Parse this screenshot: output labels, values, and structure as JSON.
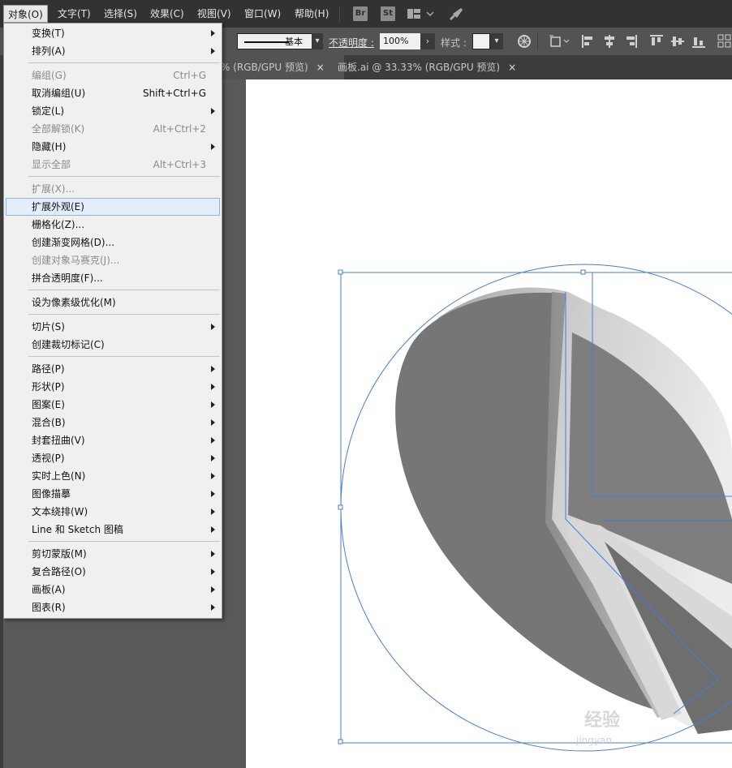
{
  "menubar": {
    "items": [
      {
        "label": "对象(O)"
      },
      {
        "label": "文字(T)"
      },
      {
        "label": "选择(S)"
      },
      {
        "label": "效果(C)"
      },
      {
        "label": "视图(V)"
      },
      {
        "label": "窗口(W)"
      },
      {
        "label": "帮助(H)"
      }
    ],
    "bridge_badge": "Br",
    "stock_badge": "St"
  },
  "control_bar": {
    "stroke_style": "基本",
    "opacity_label": "不透明度 :",
    "opacity_value": "100%",
    "style_label": "样式 :"
  },
  "tabs": [
    {
      "label": "% (RGB/GPU 预览)",
      "close": "×"
    },
    {
      "label": "画板.ai @ 33.33% (RGB/GPU 预览)",
      "close": "×"
    }
  ],
  "object_menu": {
    "items": [
      {
        "label": "变换(T)",
        "submenu": true
      },
      {
        "label": "排列(A)",
        "submenu": true
      },
      {
        "label": "编组(G)",
        "shortcut": "Ctrl+G",
        "disabled": true
      },
      {
        "label": "取消编组(U)",
        "shortcut": "Shift+Ctrl+G"
      },
      {
        "label": "锁定(L)",
        "submenu": true
      },
      {
        "label": "全部解锁(K)",
        "shortcut": "Alt+Ctrl+2",
        "disabled": true
      },
      {
        "label": "隐藏(H)",
        "submenu": true
      },
      {
        "label": "显示全部",
        "shortcut": "Alt+Ctrl+3",
        "disabled": true
      },
      {
        "label": "扩展(X)...",
        "disabled": true
      },
      {
        "label": "扩展外观(E)",
        "highlighted": true
      },
      {
        "label": "栅格化(Z)..."
      },
      {
        "label": "创建渐变网格(D)..."
      },
      {
        "label": "创建对象马赛克(J)...",
        "disabled": true
      },
      {
        "label": "拼合透明度(F)..."
      },
      {
        "label": "设为像素级优化(M)"
      },
      {
        "label": "切片(S)",
        "submenu": true
      },
      {
        "label": "创建裁切标记(C)"
      },
      {
        "label": "路径(P)",
        "submenu": true
      },
      {
        "label": "形状(P)",
        "submenu": true
      },
      {
        "label": "图案(E)",
        "submenu": true
      },
      {
        "label": "混合(B)",
        "submenu": true
      },
      {
        "label": "封套扭曲(V)",
        "submenu": true
      },
      {
        "label": "透视(P)",
        "submenu": true
      },
      {
        "label": "实时上色(N)",
        "submenu": true
      },
      {
        "label": "图像描摹",
        "submenu": true
      },
      {
        "label": "文本绕排(W)",
        "submenu": true
      },
      {
        "label": "Line 和 Sketch 图稿",
        "submenu": true
      },
      {
        "label": "剪切蒙版(M)",
        "submenu": true
      },
      {
        "label": "复合路径(O)",
        "submenu": true
      },
      {
        "label": "画板(A)",
        "submenu": true
      },
      {
        "label": "图表(R)",
        "submenu": true
      }
    ]
  },
  "watermark": {
    "main": "经验",
    "sub": "jingyan"
  },
  "colors": {
    "selection": "#4a7bdc",
    "menu_bg": "#f0f0f0",
    "highlight": "#e3eefa"
  }
}
